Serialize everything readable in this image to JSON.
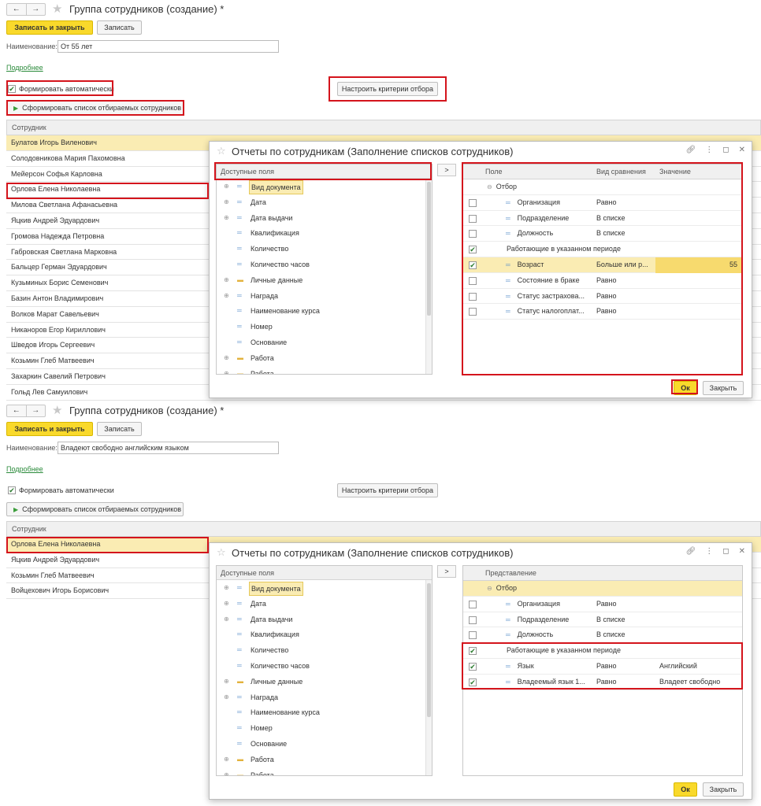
{
  "panels": [
    {
      "title": "Группа сотрудников (создание) *",
      "save_close": "Записать и закрыть",
      "save": "Записать",
      "name_label": "Наименование:",
      "name_value": "От 55 лет",
      "more": "Подробнее",
      "auto_label": "Формировать автоматически",
      "auto_checked": true,
      "criteria_btn": "Настроить критерии отбора",
      "form_list_btn": "Сформировать список отбираемых сотрудников",
      "emp_header": "Сотрудник",
      "employees": [
        "Булатов Игорь Виленович",
        "Солодовникова Мария Пахомовна",
        "Мейерсон Софья Карловна",
        "Орлова Елена Николаевна",
        "Милова Светлана Афанасьевна",
        "Яцкив Андрей Эдуардович",
        "Громова Надежда Петровна",
        "Габровская Светлана Марковна",
        "Бальцер Герман Эдуардович",
        "Кузьминых Борис Семенович",
        "Базин Антон Владимирович",
        "Волков Марат Савельевич",
        "Никаноров Егор Кириллович",
        "Шведов Игорь Сергеевич",
        "Козьмин Глеб Матвеевич",
        "Захаркин Савелий Петрович",
        "Гольд Лев Самуилович"
      ],
      "selected_employee": 0,
      "dialog": {
        "title": "Отчеты по сотрудникам (Заполнение списков сотрудников)",
        "fields_header": "Доступные поля",
        "arrow": ">",
        "fields": [
          {
            "label": "Вид документа",
            "expand": true,
            "icon": "field",
            "highlight": true
          },
          {
            "label": "Дата",
            "expand": true,
            "icon": "field"
          },
          {
            "label": "Дата выдачи",
            "expand": true,
            "icon": "field"
          },
          {
            "label": "Квалификация",
            "expand": false,
            "icon": "field"
          },
          {
            "label": "Количество",
            "expand": false,
            "icon": "field"
          },
          {
            "label": "Количество часов",
            "expand": false,
            "icon": "field"
          },
          {
            "label": "Личные данные",
            "expand": true,
            "icon": "folder"
          },
          {
            "label": "Награда",
            "expand": true,
            "icon": "field"
          },
          {
            "label": "Наименование курса",
            "expand": false,
            "icon": "field"
          },
          {
            "label": "Номер",
            "expand": false,
            "icon": "field"
          },
          {
            "label": "Основание",
            "expand": false,
            "icon": "field"
          },
          {
            "label": "Работа",
            "expand": true,
            "icon": "folder"
          },
          {
            "label": "Работа",
            "expand": true,
            "icon": "folder"
          }
        ],
        "filter_headers": [
          "Поле",
          "Вид сравнения",
          "Значение"
        ],
        "filter_group": "Отбор",
        "filter_rows": [
          {
            "checked": false,
            "field": "Организация",
            "cmp": "Равно",
            "value": "",
            "indent": true
          },
          {
            "checked": false,
            "field": "Подразделение",
            "cmp": "В списке",
            "value": "",
            "indent": true
          },
          {
            "checked": false,
            "field": "Должность",
            "cmp": "В списке",
            "value": "",
            "indent": true
          },
          {
            "checked": true,
            "field": "Работающие в указанном периоде",
            "cmp": "",
            "value": "",
            "indent": false
          },
          {
            "checked": true,
            "field": "Возраст",
            "cmp": "Больше или р...",
            "value": "55",
            "indent": true,
            "selected": true
          },
          {
            "checked": false,
            "field": "Состояние в браке",
            "cmp": "Равно",
            "value": "",
            "indent": true
          },
          {
            "checked": false,
            "field": "Статус застрахова...",
            "cmp": "Равно",
            "value": "",
            "indent": true
          },
          {
            "checked": false,
            "field": "Статус налогоплат...",
            "cmp": "Равно",
            "value": "",
            "indent": true
          }
        ],
        "ok": "Ок",
        "close": "Закрыть"
      }
    },
    {
      "title": "Группа сотрудников (создание) *",
      "save_close": "Записать и закрыть",
      "save": "Записать",
      "name_label": "Наименование:",
      "name_value": "Владеют свободно английским языком",
      "more": "Подробнее",
      "auto_label": "Формировать автоматически",
      "auto_checked": true,
      "criteria_btn": "Настроить критерии отбора",
      "form_list_btn": "Сформировать список отбираемых сотрудников",
      "emp_header": "Сотрудник",
      "employees": [
        "Орлова Елена Николаевна",
        "Яцкив Андрей Эдуардович",
        "Козьмин Глеб Матвеевич",
        "Войцехович Игорь Борисович"
      ],
      "selected_employee": 0,
      "dialog": {
        "title": "Отчеты по сотрудникам (Заполнение списков сотрудников)",
        "fields_header": "Доступные поля",
        "arrow": ">",
        "fields": [
          {
            "label": "Вид документа",
            "expand": true,
            "icon": "field",
            "highlight": true
          },
          {
            "label": "Дата",
            "expand": true,
            "icon": "field"
          },
          {
            "label": "Дата выдачи",
            "expand": true,
            "icon": "field"
          },
          {
            "label": "Квалификация",
            "expand": false,
            "icon": "field"
          },
          {
            "label": "Количество",
            "expand": false,
            "icon": "field"
          },
          {
            "label": "Количество часов",
            "expand": false,
            "icon": "field"
          },
          {
            "label": "Личные данные",
            "expand": true,
            "icon": "folder"
          },
          {
            "label": "Награда",
            "expand": true,
            "icon": "field"
          },
          {
            "label": "Наименование курса",
            "expand": false,
            "icon": "field"
          },
          {
            "label": "Номер",
            "expand": false,
            "icon": "field"
          },
          {
            "label": "Основание",
            "expand": false,
            "icon": "field"
          },
          {
            "label": "Работа",
            "expand": true,
            "icon": "folder"
          },
          {
            "label": "Работа",
            "expand": true,
            "icon": "folder"
          }
        ],
        "filter_headers": [
          "Представление",
          "",
          ""
        ],
        "filter_group": "Отбор",
        "group_selected": true,
        "filter_rows": [
          {
            "checked": false,
            "field": "Организация",
            "cmp": "Равно",
            "value": "",
            "indent": true
          },
          {
            "checked": false,
            "field": "Подразделение",
            "cmp": "В списке",
            "value": "",
            "indent": true
          },
          {
            "checked": false,
            "field": "Должность",
            "cmp": "В списке",
            "value": "",
            "indent": true
          },
          {
            "checked": true,
            "field": "Работающие в указанном периоде",
            "cmp": "",
            "value": "",
            "indent": false
          },
          {
            "checked": true,
            "field": "Язык",
            "cmp": "Равно",
            "value": "Английский",
            "indent": true
          },
          {
            "checked": true,
            "field": "Владеемый язык 1...",
            "cmp": "Равно",
            "value": "Владеет свободно",
            "indent": true
          }
        ],
        "ok": "Ок",
        "close": "Закрыть"
      }
    }
  ],
  "colors": {
    "accent_yellow": "#f9d92b",
    "selection": "#faecb3",
    "annotation_red": "#d4141c",
    "link_green": "#2a8a3a"
  }
}
